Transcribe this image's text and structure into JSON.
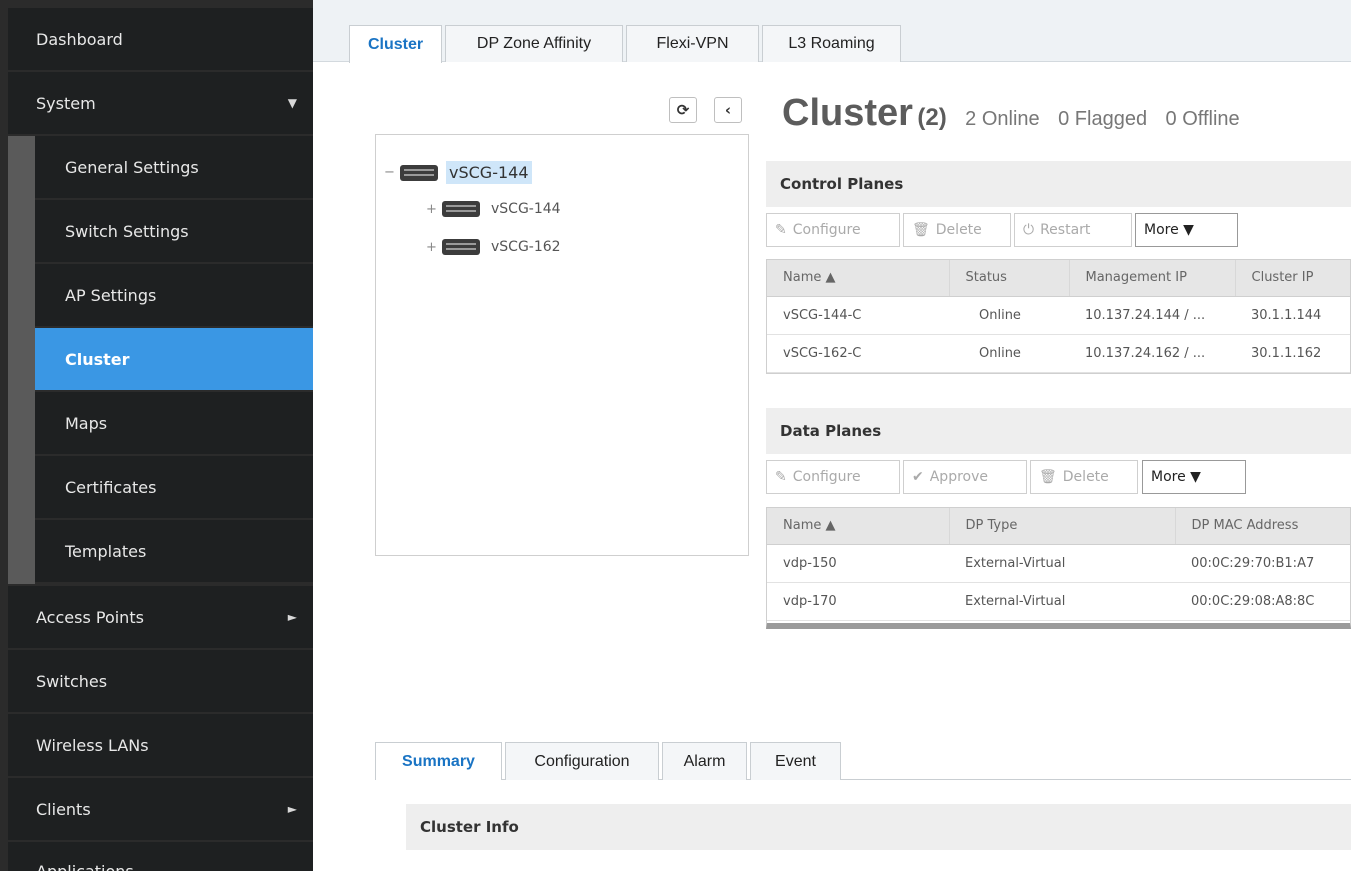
{
  "sidebar": {
    "items": [
      {
        "label": "Dashboard",
        "arrow": ""
      },
      {
        "label": "System",
        "arrow": "▼"
      },
      {
        "label": "Access Points",
        "arrow": "►"
      },
      {
        "label": "Switches",
        "arrow": ""
      },
      {
        "label": "Wireless LANs",
        "arrow": ""
      },
      {
        "label": "Clients",
        "arrow": "►"
      },
      {
        "label": "Applications",
        "arrow": ""
      }
    ],
    "system_subitems": [
      {
        "label": "General Settings"
      },
      {
        "label": "Switch Settings"
      },
      {
        "label": "AP Settings"
      },
      {
        "label": "Cluster"
      },
      {
        "label": "Maps"
      },
      {
        "label": "Certificates"
      },
      {
        "label": "Templates"
      }
    ]
  },
  "tabs": [
    {
      "label": "Cluster"
    },
    {
      "label": "DP Zone Affinity"
    },
    {
      "label": "Flexi-VPN"
    },
    {
      "label": "L3 Roaming"
    }
  ],
  "tree": {
    "root": {
      "toggle": "−",
      "label": "vSCG-144"
    },
    "children": [
      {
        "toggle": "+",
        "label": "vSCG-144"
      },
      {
        "toggle": "+",
        "label": "vSCG-162"
      }
    ]
  },
  "header": {
    "title": "Cluster",
    "count": "(2)",
    "online": "2 Online",
    "flagged": "0 Flagged",
    "offline": "0 Offline"
  },
  "control_planes": {
    "title": "Control Planes",
    "buttons": {
      "configure": "Configure",
      "delete": "Delete",
      "restart": "Restart",
      "more": "More ▼"
    },
    "columns": [
      "Name ▲",
      "Status",
      "Management IP",
      "Cluster IP"
    ],
    "rows": [
      [
        "vSCG-144-C",
        "Online",
        "10.137.24.144 / ...",
        "30.1.1.144"
      ],
      [
        "vSCG-162-C",
        "Online",
        "10.137.24.162 / ...",
        "30.1.1.162"
      ]
    ]
  },
  "data_planes": {
    "title": "Data Planes",
    "buttons": {
      "configure": "Configure",
      "approve": "Approve",
      "delete": "Delete",
      "more": "More ▼"
    },
    "columns": [
      "Name ▲",
      "DP Type",
      "DP MAC Address"
    ],
    "rows": [
      [
        "vdp-150",
        "External-Virtual",
        "00:0C:29:70:B1:A7"
      ],
      [
        "vdp-170",
        "External-Virtual",
        "00:0C:29:08:A8:8C"
      ]
    ]
  },
  "bottom_tabs": [
    {
      "label": "Summary"
    },
    {
      "label": "Configuration"
    },
    {
      "label": "Alarm"
    },
    {
      "label": "Event"
    }
  ],
  "cluster_info": {
    "title": "Cluster Info"
  },
  "icons": {
    "refresh": "refresh-icon",
    "collapse": "chevron-left-icon",
    "pencil": "pencil-icon",
    "trash": "trash-icon",
    "power": "power-icon",
    "check": "check-icon"
  },
  "colors": {
    "accent": "#3a97e4",
    "sidebar": "#1e2021",
    "tab_active": "#1a74c4"
  }
}
